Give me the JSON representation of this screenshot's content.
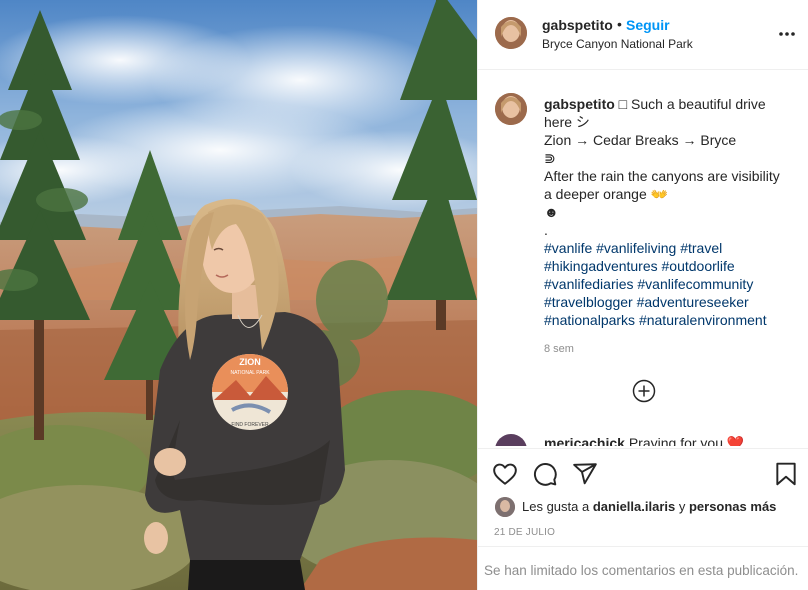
{
  "post": {
    "username": "gabspetito",
    "follow_separator": "•",
    "follow_label": "Seguir",
    "location": "Bryce Canyon National Park",
    "more_options_icon": "ellipsis-icon"
  },
  "caption": {
    "username": "gabspetito",
    "lines": [
      "□ Such a beautiful drive",
      "here シ",
      "Zion → Cedar Breaks → Bryce",
      "⋑",
      "After the rain the canyons are visibility",
      "a deeper orange 👐",
      "☻",
      "."
    ],
    "hashtag_lines": [
      "#vanlife #vanlifeliving #travel",
      "#hikingadventures #outdoorlife",
      "#vanlifediaries #vanlifecommunity",
      "#travelblogger #adventureseeker",
      "#nationalparks #naturalenvironment"
    ],
    "time_ago": "8 sem"
  },
  "comment_preview": {
    "username": "mericachick",
    "text": "Praying for you ❤️"
  },
  "actions": {
    "like_icon": "heart-icon",
    "comment_icon": "comment-icon",
    "share_icon": "send-icon",
    "save_icon": "bookmark-icon",
    "load_more_icon": "plus-circle-icon"
  },
  "likes": {
    "prefix": "Les gusta a",
    "user": "daniella.ilaris",
    "connector": "y",
    "suffix": "personas más"
  },
  "date": "21 DE JULIO",
  "comments_limited": "Se han limitado los comentarios en esta publicación.",
  "colors": {
    "link_blue": "#0095f6",
    "hashtag": "#00376b",
    "muted": "#8e8e8e",
    "text": "#262626",
    "border": "#efefef"
  }
}
